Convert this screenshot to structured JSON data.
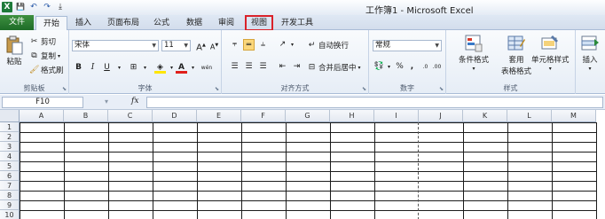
{
  "window": {
    "title": "工作簿1 - Microsoft Excel"
  },
  "qat": {
    "logo": "X",
    "save": "💾",
    "undo": "↶",
    "redo": "↷",
    "custom": "⤓"
  },
  "tabs": [
    {
      "label": "文件"
    },
    {
      "label": "开始"
    },
    {
      "label": "插入"
    },
    {
      "label": "页面布局"
    },
    {
      "label": "公式"
    },
    {
      "label": "数据"
    },
    {
      "label": "审阅"
    },
    {
      "label": "视图"
    },
    {
      "label": "开发工具"
    }
  ],
  "ribbon": {
    "clipboard": {
      "label": "剪贴板",
      "paste": "粘贴",
      "cut": "剪切",
      "copy": "复制",
      "format_painter": "格式刷"
    },
    "font": {
      "label": "字体",
      "font_name": "宋体",
      "font_size": "11",
      "grow": "A",
      "shrink": "A",
      "bold": "B",
      "italic": "I",
      "underline": "U",
      "phonetic": "wén"
    },
    "alignment": {
      "label": "对齐方式",
      "wrap": "自动换行",
      "merge": "合并后居中"
    },
    "number": {
      "label": "数字",
      "format": "常规",
      "percent": "%",
      "comma": ",",
      "inc_dec": ".0",
      "dec_dec": ".00"
    },
    "styles": {
      "label": "样式",
      "conditional": "条件格式",
      "table_format_1": "套用",
      "table_format_2": "表格格式",
      "cell_styles": "单元格样式"
    },
    "cells": {
      "insert": "插入"
    }
  },
  "formula_bar": {
    "name_box": "F10",
    "fx": "fx"
  },
  "grid": {
    "columns": [
      "A",
      "B",
      "C",
      "D",
      "E",
      "F",
      "G",
      "H",
      "I",
      "J",
      "K",
      "L",
      "M"
    ],
    "rows": [
      "1",
      "2",
      "3",
      "4",
      "5",
      "6",
      "7",
      "8",
      "9",
      "10"
    ]
  }
}
